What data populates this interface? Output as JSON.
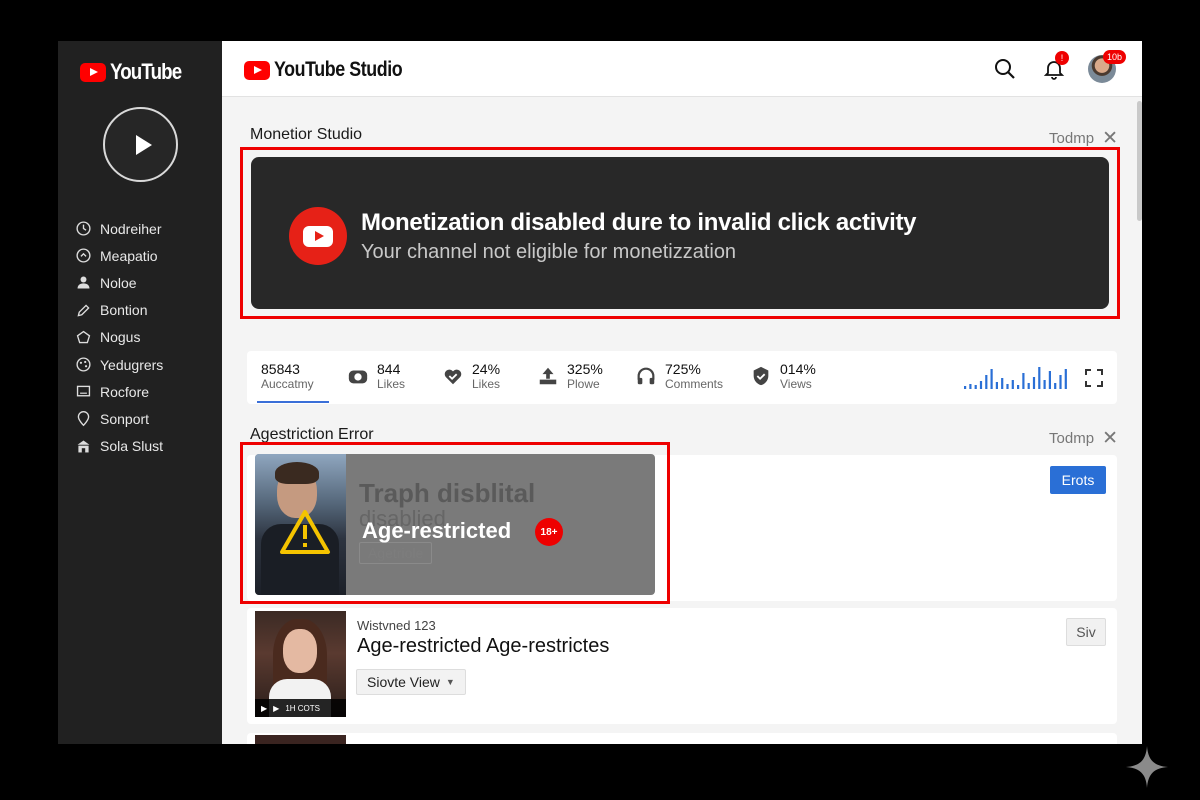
{
  "sidebar": {
    "brand": "YouTube",
    "items": [
      {
        "label": "Nodreiher",
        "icon": "clock-icon"
      },
      {
        "label": "Meapatio",
        "icon": "circle-arrow-icon"
      },
      {
        "label": "Noloe",
        "icon": "person-icon"
      },
      {
        "label": "Bontion",
        "icon": "pencil-icon"
      },
      {
        "label": "Nogus",
        "icon": "pentagon-icon"
      },
      {
        "label": "Yedugrers",
        "icon": "palette-icon"
      },
      {
        "label": "Rocfore",
        "icon": "monitor-icon"
      },
      {
        "label": "Sonport",
        "icon": "location-icon"
      },
      {
        "label": "Sola Slust",
        "icon": "store-icon"
      }
    ]
  },
  "topbar": {
    "brand": "YouTube Studio",
    "notif_badge": "!",
    "avatar_badge": "10b"
  },
  "monetization": {
    "section_title": "Monetior Studio",
    "close_label": "Todmp",
    "alert_title": "Monetization disabled dure to invalid click activity",
    "alert_sub": "Your channel not eligible for monetizzation"
  },
  "stats": [
    {
      "value": "85843",
      "label": "Auccatmy",
      "icon": "none"
    },
    {
      "value": "844",
      "label": "Likes",
      "icon": "camera-icon"
    },
    {
      "value": "24%",
      "label": "Likes",
      "icon": "heart-check-icon"
    },
    {
      "value": "325%",
      "label": "Plowe",
      "icon": "upload-icon"
    },
    {
      "value": "725%",
      "label": "Comments",
      "icon": "headphones-icon"
    },
    {
      "value": "014%",
      "label": "Views",
      "icon": "shield-icon"
    }
  ],
  "sparkline": [
    3,
    5,
    4,
    8,
    14,
    20,
    7,
    11,
    5,
    9,
    4,
    16,
    6,
    12,
    22,
    9,
    18,
    6,
    14,
    20
  ],
  "age_section": {
    "section_title": "Agestriction Error",
    "close_label": "Todmp",
    "ghost_title": "Traph disblital",
    "ghost_sub": "disablied",
    "ghost_chip": "Agetriole",
    "label": "Age-restricted",
    "badge": "18+",
    "action_button": "Erots"
  },
  "video": {
    "meta": "Wistvned 123",
    "title": "Age-restricted Age-restrictes",
    "select_label": "Siovte View",
    "button": "Siv",
    "thumb_overlay": "1H COTS"
  },
  "colors": {
    "accent_red": "#ff0000",
    "alert_card": "#282828",
    "primary_blue": "#2a6fd6"
  }
}
